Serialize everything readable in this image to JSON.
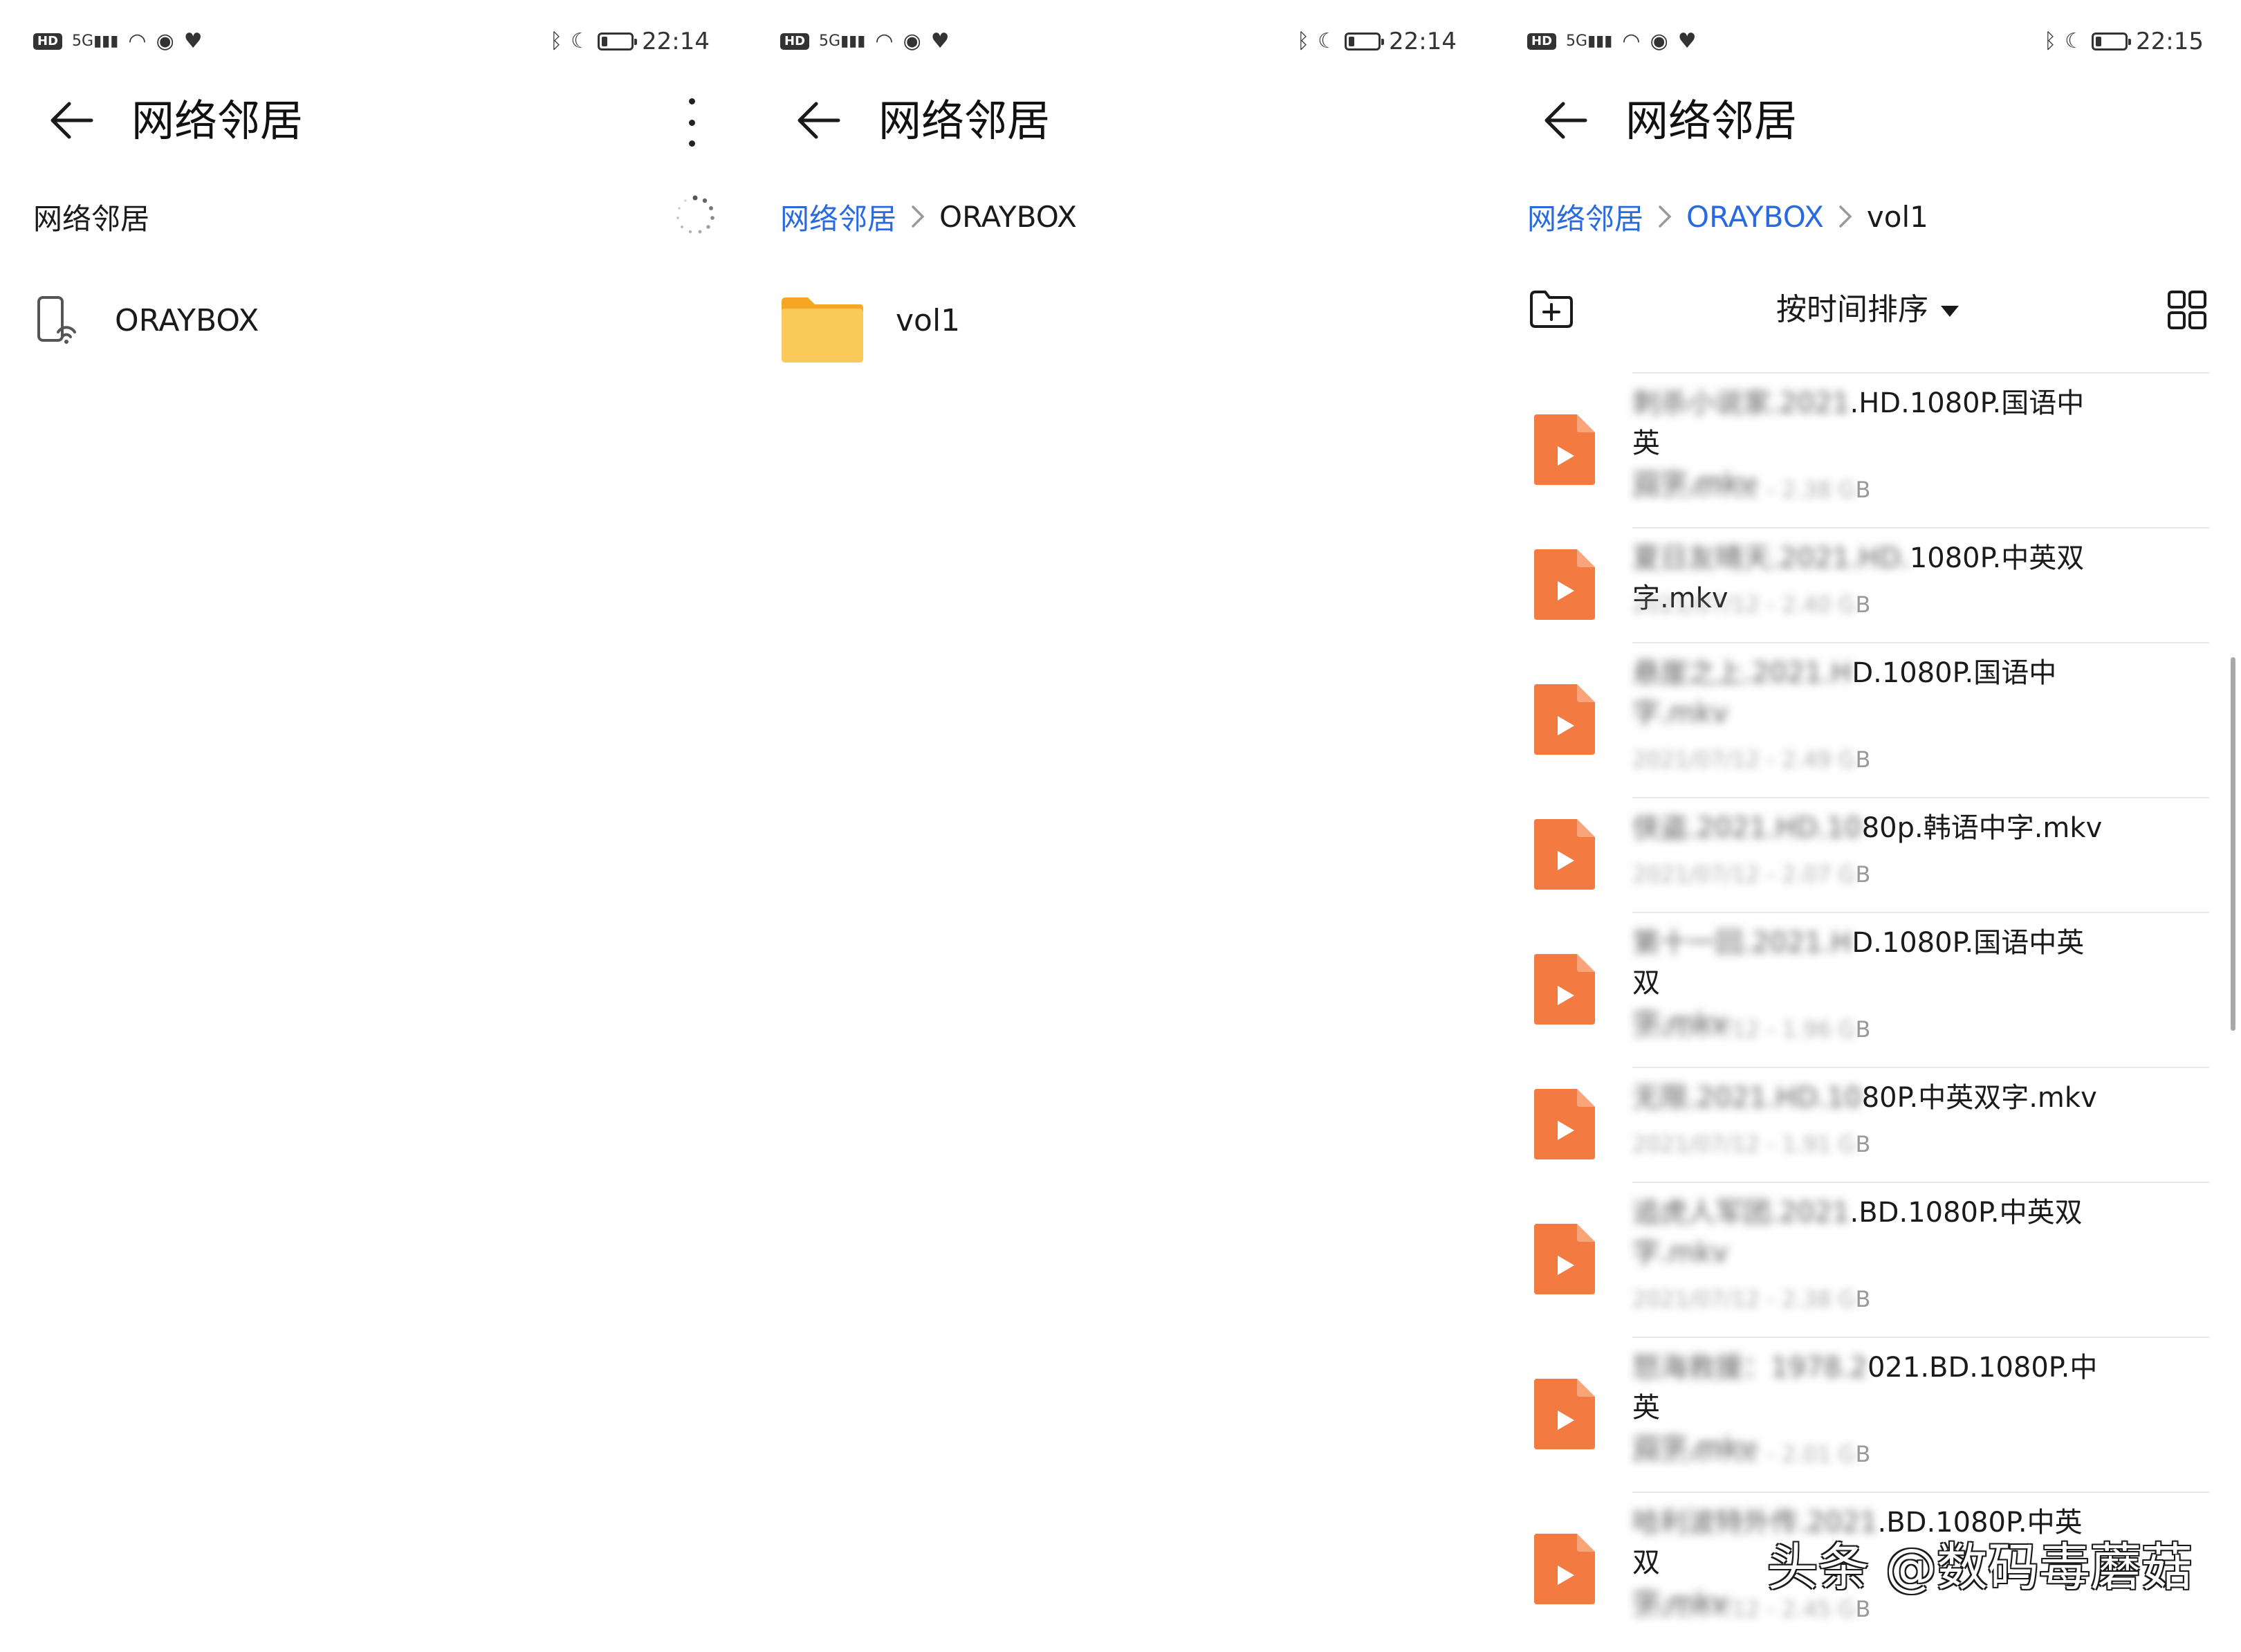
{
  "colors": {
    "link_blue": "#2a6ae0",
    "video_orange": "#f37b42",
    "folder_yellow": "#fbc95a",
    "folder_tab": "#f5a623"
  },
  "panels": [
    {
      "status": {
        "hd": "HD",
        "network": "5G",
        "time": "22:14"
      },
      "title": "网络邻居",
      "breadcrumb": [
        "网络邻居"
      ],
      "items": [
        {
          "label": "ORAYBOX",
          "icon": "network-device-icon"
        }
      ]
    },
    {
      "status": {
        "hd": "HD",
        "network": "5G",
        "time": "22:14"
      },
      "title": "网络邻居",
      "breadcrumb": [
        "网络邻居",
        "ORAYBOX"
      ],
      "items": [
        {
          "label": "vol1",
          "icon": "folder-icon"
        }
      ]
    },
    {
      "status": {
        "hd": "HD",
        "network": "5G",
        "time": "22:15"
      },
      "title": "网络邻居",
      "breadcrumb": [
        "网络邻居",
        "ORAYBOX",
        "vol1"
      ],
      "sort_label": "按时间排序",
      "files": [
        {
          "name_hidden": "刺杀小说家.2021",
          "name_visible": ".HD.1080P.国语中英",
          "name_line2": "双字.mkv",
          "meta_hidden": "2021/07/12 - 2.38 G",
          "meta_visible": "B"
        },
        {
          "name_hidden": "夏日友晴天.2021.HD.",
          "name_visible": "1080P.中英双字.mkv",
          "name_line2": "",
          "meta_hidden": "2021/07/12 - 2.40 G",
          "meta_visible": "B"
        },
        {
          "name_hidden": "悬崖之上.2021.H",
          "name_visible": "D.1080P.国语中",
          "name_line2": "字.mkv",
          "meta_hidden": "2021/07/12 - 2.49 G",
          "meta_visible": "B"
        },
        {
          "name_hidden": "侠盗.2021.HD.10",
          "name_visible": "80p.韩语中字.mkv",
          "name_line2": "",
          "meta_hidden": "2021/07/12 - 2.07 G",
          "meta_visible": "B"
        },
        {
          "name_hidden": "第十一回.2021.H",
          "name_visible": "D.1080P.国语中英双",
          "name_line2": "字.mkv",
          "meta_hidden": "2021/07/12 - 1.96 G",
          "meta_visible": "B"
        },
        {
          "name_hidden": "无限.2021.HD.10",
          "name_visible": "80P.中英双字.mkv",
          "name_line2": "",
          "meta_hidden": "2021/07/12 - 1.91 G",
          "meta_visible": "B"
        },
        {
          "name_hidden": "追虎人军团.2021",
          "name_visible": ".BD.1080P.中英双",
          "name_line2": "字.mkv",
          "meta_hidden": "2021/07/12 - 2.38 G",
          "meta_visible": "B"
        },
        {
          "name_hidden": "怒海救援：1978.2",
          "name_visible": "021.BD.1080P.中英",
          "name_line2": "双字.mkv",
          "meta_hidden": "2021/07/12 - 2.01 G",
          "meta_visible": "B"
        },
        {
          "name_hidden": "哈利波特外传.2021",
          "name_visible": ".BD.1080P.中英双",
          "name_line2": "字.mkv",
          "meta_hidden": "2021/07/12 - 2.45 G",
          "meta_visible": "B"
        }
      ]
    }
  ],
  "watermark": "头条 @数码毒蘑菇"
}
